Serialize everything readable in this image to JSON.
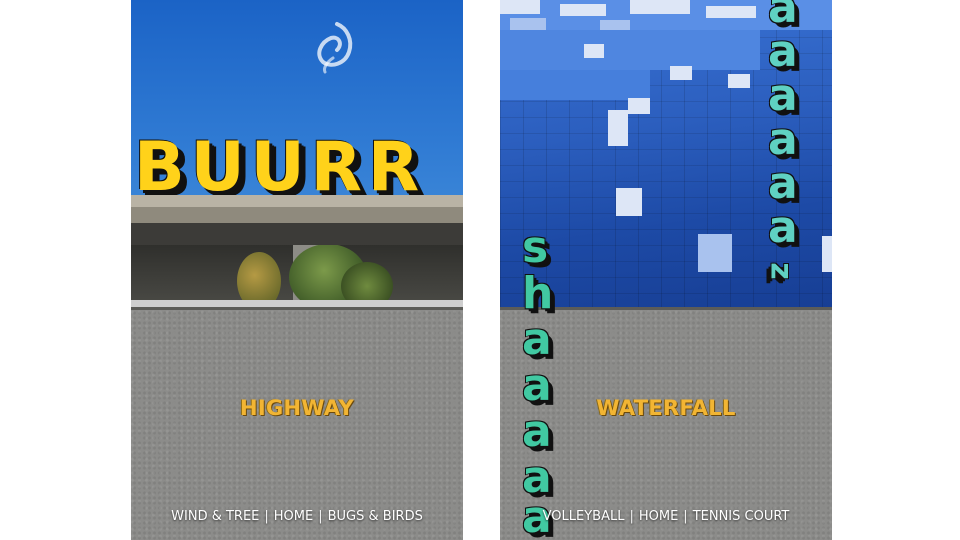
{
  "left_panel": {
    "sign_text": "BUURR",
    "title": "HIGHWAY",
    "nav": [
      "WIND & TREE",
      "HOME",
      "BUGS & BIRDS"
    ],
    "nav_separator": "|"
  },
  "right_panel": {
    "sound_word_left": [
      "s",
      "h",
      "a",
      "a",
      "a",
      "a",
      "a"
    ],
    "sound_word_right": [
      "a",
      "a",
      "a",
      "a",
      "a",
      "a",
      "z"
    ],
    "title": "WATERFALL",
    "nav": [
      "VOLLEYBALL",
      "HOME",
      "TENNIS COURT"
    ],
    "nav_separator": "|"
  },
  "colors": {
    "title": "#f2b533",
    "sign_yellow": "#ffd21a",
    "letter_green": "#41c9a2"
  }
}
